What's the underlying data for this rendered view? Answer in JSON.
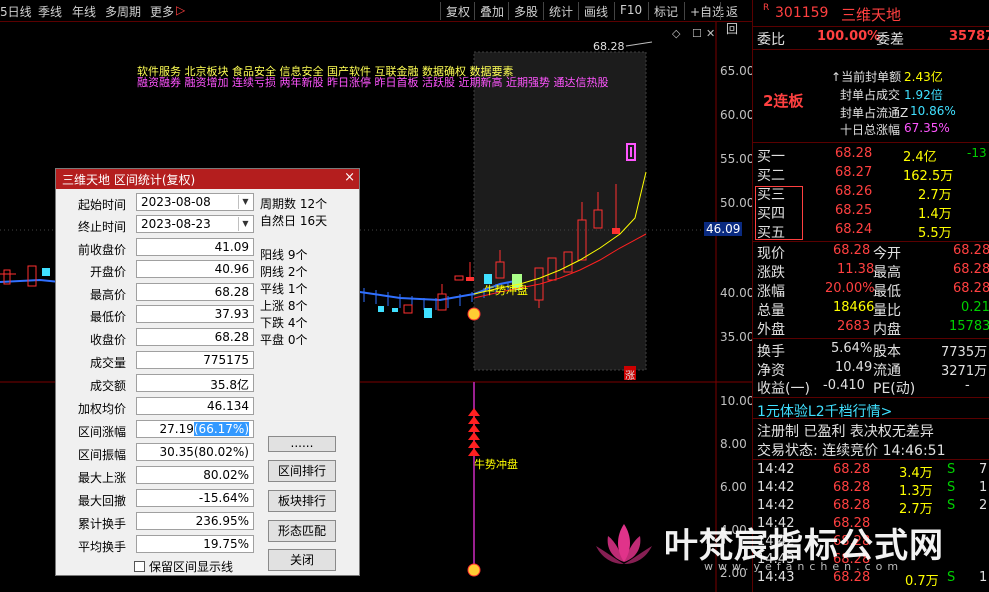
{
  "toolbar": {
    "left_tabs": [
      "5日线",
      "季线",
      "年线",
      "多周期",
      "更多"
    ],
    "right_buttons": [
      "复权",
      "叠加",
      "多股",
      "统计",
      "画线",
      "F10",
      "标记",
      "+自选",
      "返回"
    ],
    "more_arrow": "▷"
  },
  "chart": {
    "tags_line1": "软件服务  北京板块  食品安全 信息安全 国产软件 互联金融 数据确权 数据要素",
    "tags_line2": "融资融券 融资增加 连续亏损 两年新股 昨日涨停 昨日首板 活跃股 近期新高 近期强势 通达信热股",
    "peak_label": "68.28",
    "y_axis_main": [
      "65.00",
      "60.00",
      "55.00",
      "50.00",
      "40.00",
      "35.00"
    ],
    "current_price_tag": "46.09",
    "y_axis_sub": [
      "10.00",
      "8.00",
      "6.00",
      "4.00",
      "2.00"
    ],
    "signal_label_1": "牛势冲盘",
    "signal_label_2": "牛势冲盘",
    "zhang_label": "涨",
    "colors": {
      "up": "#ff3030",
      "down": "#40e0ff",
      "ma_yellow": "#ffff00",
      "ma_red": "#ff2020",
      "ma_blue": "#3070ff",
      "bg": "#000000"
    }
  },
  "dialog": {
    "title": "三维天地 区间统计(复权)",
    "close": "×",
    "start_label": "起始时间",
    "start_value": "2023-08-08",
    "end_label": "终止时间",
    "end_value": "2023-08-23",
    "fields": [
      {
        "label": "前收盘价",
        "value": "41.09"
      },
      {
        "label": "开盘价",
        "value": "40.96"
      },
      {
        "label": "最高价",
        "value": "68.28"
      },
      {
        "label": "最低价",
        "value": "37.93"
      },
      {
        "label": "收盘价",
        "value": "68.28"
      },
      {
        "label": "成交量",
        "value": "775175"
      },
      {
        "label": "成交额",
        "value": "35.8亿"
      },
      {
        "label": "加权均价",
        "value": "46.134"
      },
      {
        "label": "区间涨幅",
        "value": "27.19",
        "value_hl": "(66.17%)"
      },
      {
        "label": "区间振幅",
        "value": "30.35(80.02%)"
      },
      {
        "label": "最大上涨",
        "value": "80.02%"
      },
      {
        "label": "最大回撤",
        "value": "-15.64%"
      },
      {
        "label": "累计换手",
        "value": "236.95%"
      },
      {
        "label": "平均换手",
        "value": "19.75%"
      }
    ],
    "stats": [
      "周期数 12个",
      "自然日 16天",
      "阳线 9个",
      "阴线 2个",
      "平线 1个",
      "上涨 8个",
      "下跌 4个",
      "平盘 0个"
    ],
    "buttons": [
      "......",
      "区间排行",
      "板块排行",
      "形态匹配",
      "关闭"
    ],
    "checkbox_label": "保留区间显示线"
  },
  "panel": {
    "code_prefix": "R",
    "code": "301159",
    "name": "三维天地",
    "weibi_label": "委比",
    "weibi": "100.00%",
    "weicha_label": "委差",
    "weicha": "35787",
    "lianban": "2连板",
    "seal": [
      {
        "label": "当前封单额",
        "value": "2.43亿",
        "color": "yellow"
      },
      {
        "label": "封单占成交",
        "value": "1.92倍",
        "color": "cyan"
      },
      {
        "label": "封单占流通Z",
        "value": "10.86%",
        "color": "cyan"
      },
      {
        "label": "十日总涨幅",
        "value": "67.35%",
        "color": "mag"
      }
    ],
    "bids": [
      {
        "label": "买一",
        "price": "68.28",
        "vol": "2.4亿",
        "chg": "-13"
      },
      {
        "label": "买二",
        "price": "68.27",
        "vol": "162.5万",
        "chg": ""
      },
      {
        "label": "买三",
        "price": "68.26",
        "vol": "2.7万",
        "chg": ""
      },
      {
        "label": "买四",
        "price": "68.25",
        "vol": "1.4万",
        "chg": ""
      },
      {
        "label": "买五",
        "price": "68.24",
        "vol": "5.5万",
        "chg": ""
      }
    ],
    "quote": [
      {
        "l1": "现价",
        "v1": "68.28",
        "c1": "red",
        "l2": "今开",
        "v2": "68.28",
        "c2": "red"
      },
      {
        "l1": "涨跌",
        "v1": "11.38",
        "c1": "red",
        "l2": "最高",
        "v2": "68.28",
        "c2": "red"
      },
      {
        "l1": "涨幅",
        "v1": "20.00%",
        "c1": "red",
        "l2": "最低",
        "v2": "68.28",
        "c2": "red"
      },
      {
        "l1": "总量",
        "v1": "18466",
        "c1": "yellow",
        "l2": "量比",
        "v2": "0.21",
        "c2": "green"
      },
      {
        "l1": "外盘",
        "v1": "2683",
        "c1": "red",
        "l2": "内盘",
        "v2": "15783",
        "c2": "green"
      }
    ],
    "fund": [
      {
        "l1": "换手",
        "v1": "5.64%",
        "l2": "股本",
        "v2": "7735万"
      },
      {
        "l1": "净资",
        "v1": "10.49",
        "l2": "流通",
        "v2": "3271万"
      },
      {
        "l1": "收益(一)",
        "v1": "-0.410",
        "l2": "PE(动)",
        "v2": "-"
      }
    ],
    "promo": "1元体验L2千档行情>",
    "reg": "注册制 已盈利 表决权无差异",
    "trade_status": "交易状态: 连续竞价 14:46:51",
    "ticks": [
      {
        "time": "14:42",
        "price": "68.28",
        "vol": "3.4万",
        "bs": "S"
      },
      {
        "time": "14:42",
        "price": "68.28",
        "vol": "1.3万",
        "bs": "S"
      },
      {
        "time": "14:42",
        "price": "68.28",
        "vol": "2.7万",
        "bs": "S"
      },
      {
        "time": "14:42",
        "price": "68.28",
        "vol": "",
        "bs": ""
      },
      {
        "time": "14:42",
        "price": "68.28",
        "vol": "",
        "bs": ""
      },
      {
        "time": "14:43",
        "price": "68.28",
        "vol": "",
        "bs": ""
      },
      {
        "time": "14:43",
        "price": "68.28",
        "vol": "0.7万",
        "bs": "S"
      }
    ],
    "tick_suffix": [
      "7",
      "1",
      "2",
      "",
      "",
      "",
      "1"
    ]
  },
  "watermark": {
    "text": "叶梵宸指标公式网",
    "url": "www.yefanchen.com"
  }
}
